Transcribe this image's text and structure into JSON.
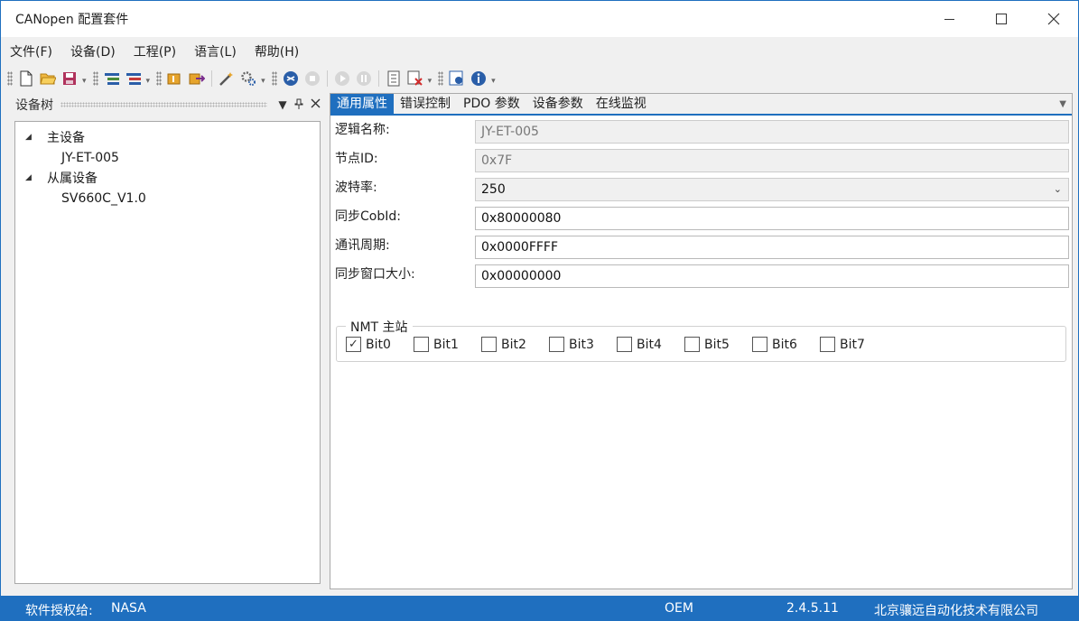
{
  "window": {
    "title": "CANopen 配置套件"
  },
  "menu": [
    {
      "label": "文件(F)"
    },
    {
      "label": "设备(D)"
    },
    {
      "label": "工程(P)"
    },
    {
      "label": "语言(L)"
    },
    {
      "label": "帮助(H)"
    }
  ],
  "toolbar": {
    "icons": [
      "new-file-icon",
      "open-folder-icon",
      "save-icon",
      "add-node-icon",
      "remove-node-icon",
      "import-icon",
      "export-icon",
      "wizard-icon",
      "settings-icon",
      "connect-icon",
      "stop-icon",
      "play-icon",
      "pause-icon",
      "download-icon",
      "delete-icon",
      "config-icon",
      "info-icon"
    ]
  },
  "device_tree": {
    "title": "设备树",
    "nodes": [
      {
        "label": "主设备",
        "level": 0
      },
      {
        "label": "JY-ET-005",
        "level": 1
      },
      {
        "label": "从属设备",
        "level": 0
      },
      {
        "label": "SV660C_V1.0",
        "level": 1
      }
    ]
  },
  "tabs": [
    {
      "label": "通用属性",
      "active": true
    },
    {
      "label": "错误控制",
      "active": false
    },
    {
      "label": "PDO 参数",
      "active": false
    },
    {
      "label": "设备参数",
      "active": false
    },
    {
      "label": "在线监视",
      "active": false
    }
  ],
  "form": {
    "logic_name": {
      "label": "逻辑名称:",
      "value": "JY-ET-005"
    },
    "node_id": {
      "label": "节点ID:",
      "value": "0x7F"
    },
    "baud_rate": {
      "label": "波特率:",
      "value": "250"
    },
    "sync_cobid": {
      "label": "同步CobId:",
      "value": "0x80000080"
    },
    "comm_period": {
      "label": "通讯周期:",
      "value": "0x0000FFFF"
    },
    "sync_window": {
      "label": "同步窗口大小:",
      "value": "0x00000000"
    }
  },
  "nmt_master": {
    "legend": "NMT 主站",
    "bits": [
      {
        "label": "Bit0",
        "checked": true
      },
      {
        "label": "Bit1",
        "checked": false
      },
      {
        "label": "Bit2",
        "checked": false
      },
      {
        "label": "Bit3",
        "checked": false
      },
      {
        "label": "Bit4",
        "checked": false
      },
      {
        "label": "Bit5",
        "checked": false
      },
      {
        "label": "Bit6",
        "checked": false
      },
      {
        "label": "Bit7",
        "checked": false
      }
    ]
  },
  "status": {
    "license_label": "软件授权给:",
    "license_value": "NASA",
    "oem": "OEM",
    "version": "2.4.5.11",
    "company": "北京骧远自动化技术有限公司"
  },
  "colors": {
    "accent": "#1f6fbf"
  }
}
